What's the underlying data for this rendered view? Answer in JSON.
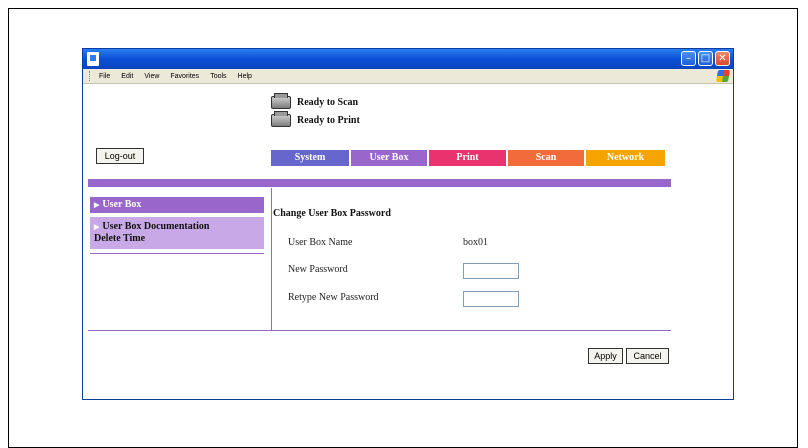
{
  "menu": [
    "File",
    "Edit",
    "View",
    "Favorites",
    "Tools",
    "Help"
  ],
  "status": {
    "scanner": "Ready to Scan",
    "printer": "Ready to Print"
  },
  "logout_label": "Log-out",
  "tabs": [
    {
      "label": "System",
      "color": "#6666cc"
    },
    {
      "label": "User Box",
      "color": "#9966cc"
    },
    {
      "label": "Print",
      "color": "#e8336e"
    },
    {
      "label": "Scan",
      "color": "#f26b3a"
    },
    {
      "label": "Network",
      "color": "#f5a400"
    }
  ],
  "sidebar": {
    "items": [
      {
        "label": "User Box"
      },
      {
        "label_line1": "User Box Documentation",
        "label_line2": "Delete Time"
      }
    ]
  },
  "main": {
    "title": "Change User Box Password",
    "rows": [
      {
        "label": "User Box Name",
        "value": "box01"
      },
      {
        "label": "New Password",
        "value": ""
      },
      {
        "label": "Retype New Password",
        "value": ""
      }
    ]
  },
  "buttons": {
    "apply": "Apply",
    "cancel": "Cancel"
  },
  "colors": {
    "accent": "#9966cc",
    "accent_light": "#c8a8e6",
    "titlebar": "#0a4fd4"
  }
}
